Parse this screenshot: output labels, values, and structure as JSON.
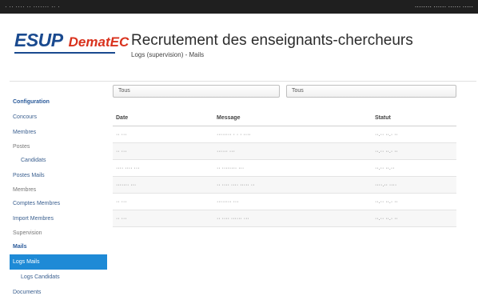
{
  "topbar": {
    "left_text": "· ·· ···· ·· ······· ·· ·",
    "right_text": "········ ······ ······ ·····"
  },
  "logo": {
    "esup": "ESUP",
    "demat": "DematEC"
  },
  "header": {
    "title": "Recrutement des enseignants-chercheurs",
    "subtitle": "Logs (supervision) - Mails"
  },
  "sidebar": {
    "items": [
      {
        "label": "Configuration",
        "kind": "bold"
      },
      {
        "label": "Concours",
        "kind": "link"
      },
      {
        "label": "Membres",
        "kind": "link"
      },
      {
        "label": "Postes",
        "kind": "section"
      },
      {
        "label": "Candidats",
        "kind": "indent"
      },
      {
        "label": "Postes Mails",
        "kind": "link"
      },
      {
        "label": "Membres",
        "kind": "section"
      },
      {
        "label": "Comptes Membres",
        "kind": "link"
      },
      {
        "label": "Import Membres",
        "kind": "link"
      },
      {
        "label": "Supervision",
        "kind": "section"
      },
      {
        "label": "Mails",
        "kind": "bold"
      },
      {
        "label": "Logs Mails",
        "kind": "active"
      },
      {
        "label": "Logs Candidats",
        "kind": "indent"
      },
      {
        "label": "Documents",
        "kind": "link"
      }
    ]
  },
  "filters": {
    "first": "Tous",
    "second": "Tous"
  },
  "table": {
    "headers": [
      "Date",
      "Message",
      "Statut"
    ],
    "rows": [
      {
        "date": "·· ···",
        "message": "········ · · · ····",
        "status": "··.·· ··.· ··"
      },
      {
        "date": "·· ···",
        "message": "······ ···",
        "status": "··.·· ··.· ··"
      },
      {
        "date": "···· ···· ···",
        "message": "·· ········ ···",
        "status": "··.·· ··.··"
      },
      {
        "date": "······· ···",
        "message": "·· ···· ···· ····· ··",
        "status": "····.·· ····"
      },
      {
        "date": "·· ···",
        "message": "········ ···",
        "status": "··.·· ··.· ··"
      },
      {
        "date": "·· ···",
        "message": "·· ···· ······ ···",
        "status": "··.·· ··.· ··"
      }
    ]
  },
  "colors": {
    "brand_blue": "#1a4a8f",
    "brand_red": "#d9321d",
    "active_blue": "#1e8ad6",
    "topbar": "#1f1f1f"
  }
}
